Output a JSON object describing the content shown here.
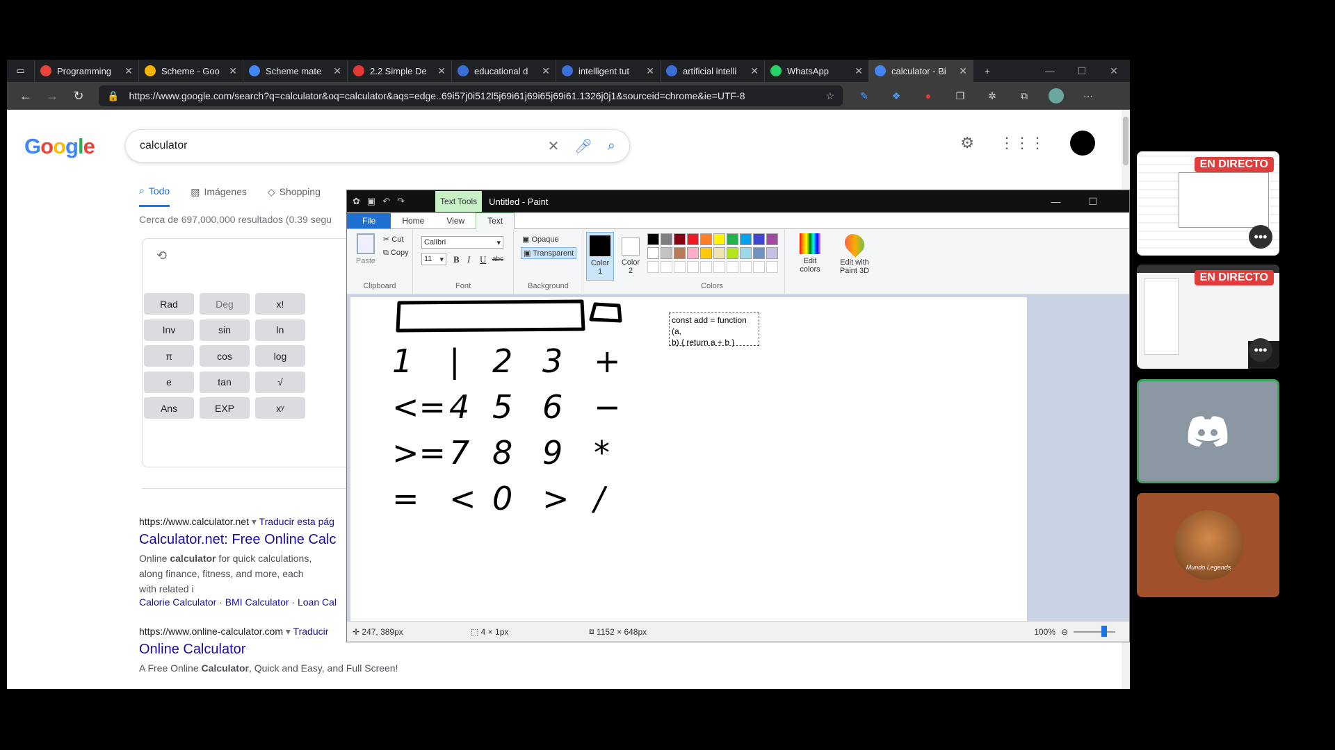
{
  "browser": {
    "tabs": [
      {
        "title": "Programming",
        "color": "#e8463c"
      },
      {
        "title": "Scheme - Goo",
        "color": "#f4b400"
      },
      {
        "title": "Scheme mate",
        "color": "#4285f4"
      },
      {
        "title": "2.2 Simple De",
        "color": "#e53935"
      },
      {
        "title": "educational d",
        "color": "#3b6fd8"
      },
      {
        "title": "intelligent tut",
        "color": "#3b6fd8"
      },
      {
        "title": "artificial intelli",
        "color": "#3b6fd8"
      },
      {
        "title": "WhatsApp",
        "color": "#25d366"
      },
      {
        "title": "calculator - Bi",
        "color": "#4285f4"
      }
    ],
    "new_tab": "+",
    "window_controls": {
      "minimize": "—",
      "maximize": "☐",
      "close": "✕"
    },
    "url": "https://www.google.com/search?q=calculator&oq=calculator&aqs=edge..69i57j0i512l5j69i61j69i65j69i61.1326j0j1&sourceid=chrome&ie=UTF-8"
  },
  "google": {
    "logo": "Google",
    "query": "calculator",
    "tabs": [
      {
        "label": "Todo",
        "icon": "search-icon"
      },
      {
        "label": "Imágenes",
        "icon": "image-icon"
      },
      {
        "label": "Shopping",
        "icon": "tag-icon"
      }
    ],
    "result_count": "Cerca de 697,000,000 resultados (0.39 segu",
    "calculator": {
      "buttons": [
        [
          "Rad",
          "Deg",
          "x!"
        ],
        [
          "Inv",
          "sin",
          "ln"
        ],
        [
          "π",
          "cos",
          "log"
        ],
        [
          "e",
          "tan",
          "√"
        ],
        [
          "Ans",
          "EXP",
          "xʸ"
        ]
      ]
    },
    "results": [
      {
        "cite": "https://www.calculator.net",
        "translate": "Traducir esta pág",
        "title": "Calculator.net: Free Online Calc",
        "snippet": "Online calculator for quick calculations, along finance, fitness, and more, each with related i",
        "links": "Calorie Calculator · BMI Calculator · Loan Cal"
      },
      {
        "cite": "https://www.online-calculator.com",
        "translate": "Traducir",
        "title": "Online Calculator",
        "snippet": "A Free Online Calculator, Quick and Easy, and Full Screen!"
      }
    ]
  },
  "paint": {
    "title": "Untitled - Paint",
    "context_tab": "Text Tools",
    "menu": [
      "File",
      "Home",
      "View",
      "Text"
    ],
    "clipboard": {
      "paste": "Paste",
      "cut": "Cut",
      "copy": "Copy",
      "label": "Clipboard"
    },
    "font": {
      "family": "Calibri",
      "size": "11",
      "bold": "B",
      "italic": "I",
      "underline": "U",
      "strike": "abc",
      "label": "Font"
    },
    "background": {
      "opaque": "Opaque",
      "transparent": "Transparent",
      "label": "Background"
    },
    "colors": {
      "color1": "Color 1",
      "color2": "Color 2",
      "edit": "Edit colors",
      "paint3d": "Edit with Paint 3D",
      "label": "Colors",
      "palette_row1": [
        "#000000",
        "#7f7f7f",
        "#880015",
        "#ed1c24",
        "#ff7f27",
        "#fff200",
        "#22b14c",
        "#00a2e8",
        "#3f48cc",
        "#a349a4"
      ],
      "palette_row2": [
        "#ffffff",
        "#c3c3c3",
        "#b97a57",
        "#ffaec9",
        "#ffc90e",
        "#efe4b0",
        "#b5e61d",
        "#99d9ea",
        "#7092be",
        "#c8bfe7"
      ]
    },
    "canvas_text": [
      "const add = function (a,",
      "b) { return a + b }"
    ],
    "handwriting": {
      "row1": [
        "1",
        "|",
        "2",
        "3",
        "+"
      ],
      "row2": [
        "<=",
        "4",
        "5",
        "6",
        "−"
      ],
      "row3": [
        ">=",
        "7",
        "8",
        "9",
        "*"
      ],
      "row4": [
        "=",
        "<",
        "0",
        ">",
        "/"
      ]
    },
    "status": {
      "cursor": "247, 389px",
      "selection": "4 × 1px",
      "size": "1152 × 648px",
      "zoom": "100%"
    }
  },
  "call": {
    "live_label": "EN DIRECTO",
    "avatar_caption": "Mundo Legends"
  }
}
